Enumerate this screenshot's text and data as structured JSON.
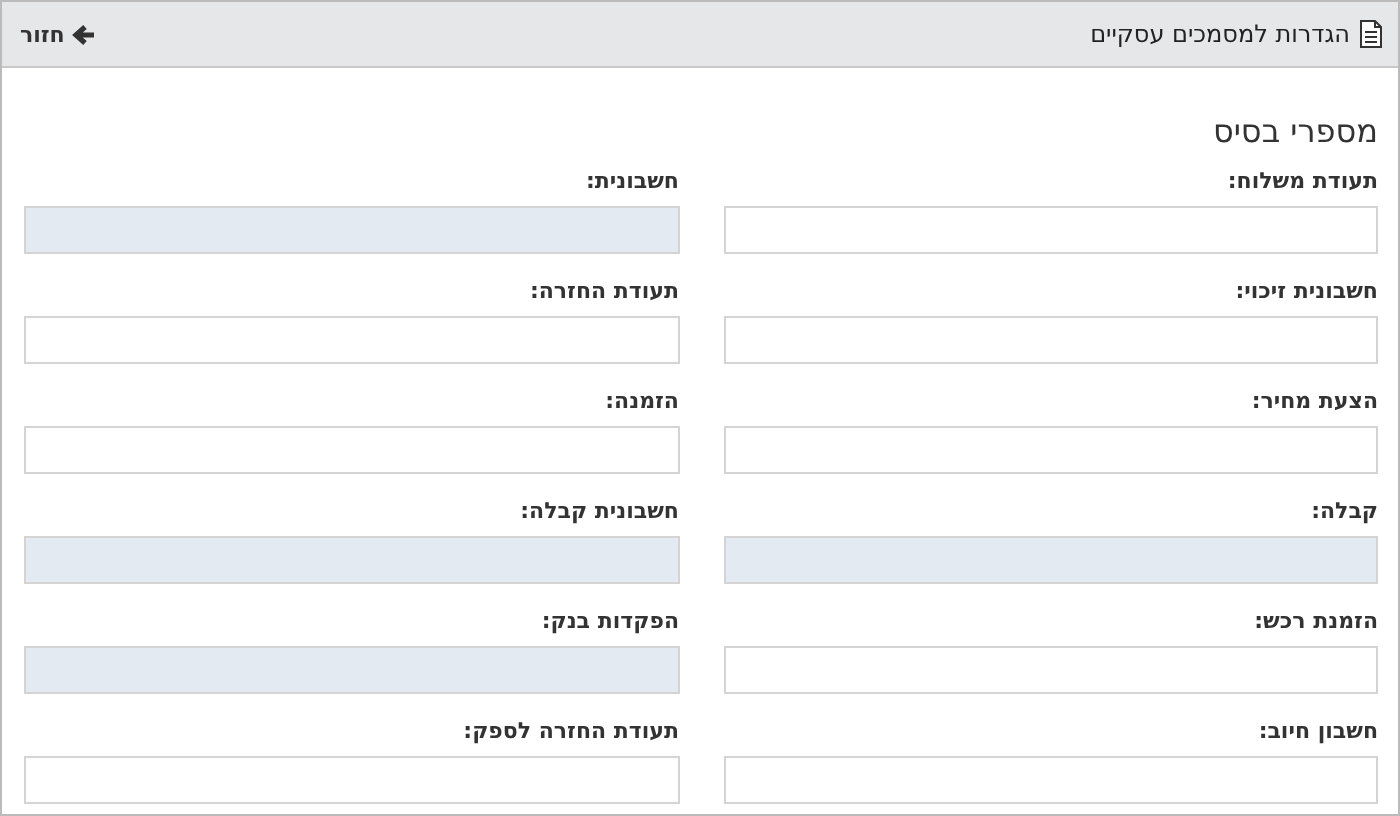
{
  "header": {
    "title": "הגדרות למסמכים עסקיים",
    "back": "חזור"
  },
  "section": {
    "title": "מספרי בסיס"
  },
  "fields": [
    {
      "label": "תעודת משלוח:",
      "disabled": false
    },
    {
      "label": "חשבונית:",
      "disabled": true
    },
    {
      "label": "חשבונית זיכוי:",
      "disabled": false
    },
    {
      "label": "תעודת החזרה:",
      "disabled": false
    },
    {
      "label": "הצעת מחיר:",
      "disabled": false
    },
    {
      "label": "הזמנה:",
      "disabled": false
    },
    {
      "label": "קבלה:",
      "disabled": true
    },
    {
      "label": "חשבונית קבלה:",
      "disabled": true
    },
    {
      "label": "הזמנת רכש:",
      "disabled": false
    },
    {
      "label": "הפקדות בנק:",
      "disabled": true
    },
    {
      "label": "חשבון חיוב:",
      "disabled": false
    },
    {
      "label": "תעודת החזרה לספק:",
      "disabled": false
    }
  ]
}
